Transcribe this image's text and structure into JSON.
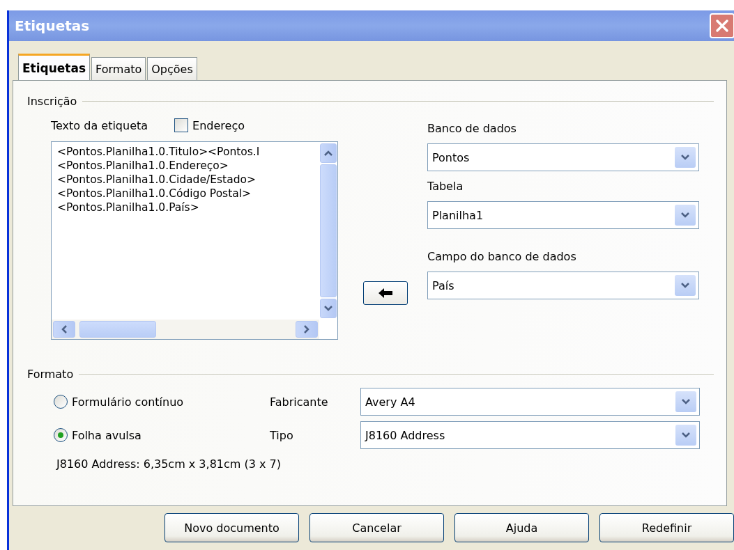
{
  "window": {
    "title": "Etiquetas"
  },
  "tabs": [
    {
      "label": "Etiquetas",
      "selected": true
    },
    {
      "label": "Formato",
      "selected": false
    },
    {
      "label": "Opções",
      "selected": false
    }
  ],
  "inscription": {
    "title": "Inscrição",
    "text_label": "Texto da etiqueta",
    "address_checkbox": {
      "label": "Endereço",
      "checked": false
    },
    "text_lines": [
      "<Pontos.Planilha1.0.Titulo><Pontos.I",
      "<Pontos.Planilha1.0.Endereço>",
      "<Pontos.Planilha1.0.Cidade/Estado>",
      "<Pontos.Planilha1.0.Código Postal>",
      "<Pontos.Planilha1.0.País>"
    ],
    "selects": [
      {
        "label": "Banco de dados",
        "value": "Pontos"
      },
      {
        "label": "Tabela",
        "value": "Planilha1"
      },
      {
        "label": "Campo do banco de dados",
        "value": "País"
      }
    ]
  },
  "format": {
    "title": "Formato",
    "options": [
      {
        "label": "Formulário contínuo",
        "selected": false
      },
      {
        "label": "Folha avulsa",
        "selected": true
      }
    ],
    "selects": [
      {
        "label": "Fabricante",
        "value": "Avery A4"
      },
      {
        "label": "Tipo",
        "value": "J8160 Address"
      }
    ],
    "summary": "J8160 Address: 6,35cm x 3,81cm (3 x 7)"
  },
  "buttons": [
    "Novo documento",
    "Cancelar",
    "Ajuda",
    "Redefinir"
  ]
}
